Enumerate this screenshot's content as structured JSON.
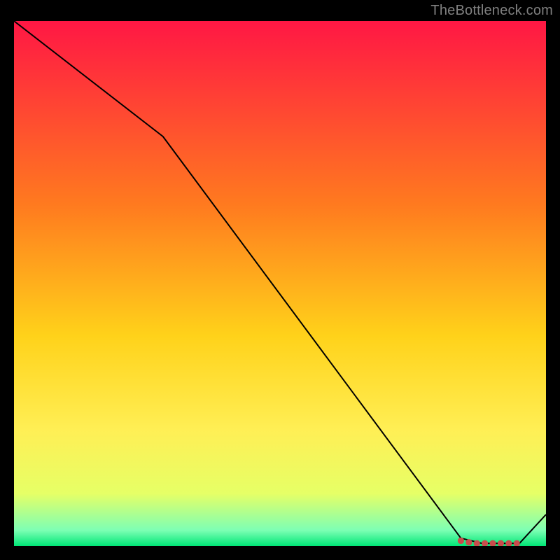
{
  "attribution": "TheBottleneck.com",
  "chart_data": {
    "type": "line",
    "title": "",
    "xlabel": "",
    "ylabel": "",
    "xlim": [
      0,
      100
    ],
    "ylim": [
      0,
      100
    ],
    "gradient_stops": [
      {
        "offset": 0,
        "color": "#ff1744"
      },
      {
        "offset": 35,
        "color": "#ff7a1f"
      },
      {
        "offset": 60,
        "color": "#ffd21a"
      },
      {
        "offset": 78,
        "color": "#ffef55"
      },
      {
        "offset": 90,
        "color": "#e6ff66"
      },
      {
        "offset": 97,
        "color": "#7dffb4"
      },
      {
        "offset": 100,
        "color": "#00e676"
      }
    ],
    "series": [
      {
        "name": "bottleneck-curve",
        "x": [
          0,
          28,
          84,
          88,
          95,
          100
        ],
        "y": [
          100,
          78,
          1.5,
          0.5,
          0.5,
          6
        ],
        "stroke": "#000000",
        "stroke_width": 2
      }
    ],
    "markers": [
      {
        "name": "optimal-range",
        "x": [
          84,
          85.5,
          87,
          88.5,
          90,
          91.5,
          93,
          94.5
        ],
        "y": [
          1.0,
          0.7,
          0.5,
          0.5,
          0.5,
          0.5,
          0.5,
          0.5
        ],
        "color": "#c94c4c",
        "size": 9
      }
    ]
  }
}
